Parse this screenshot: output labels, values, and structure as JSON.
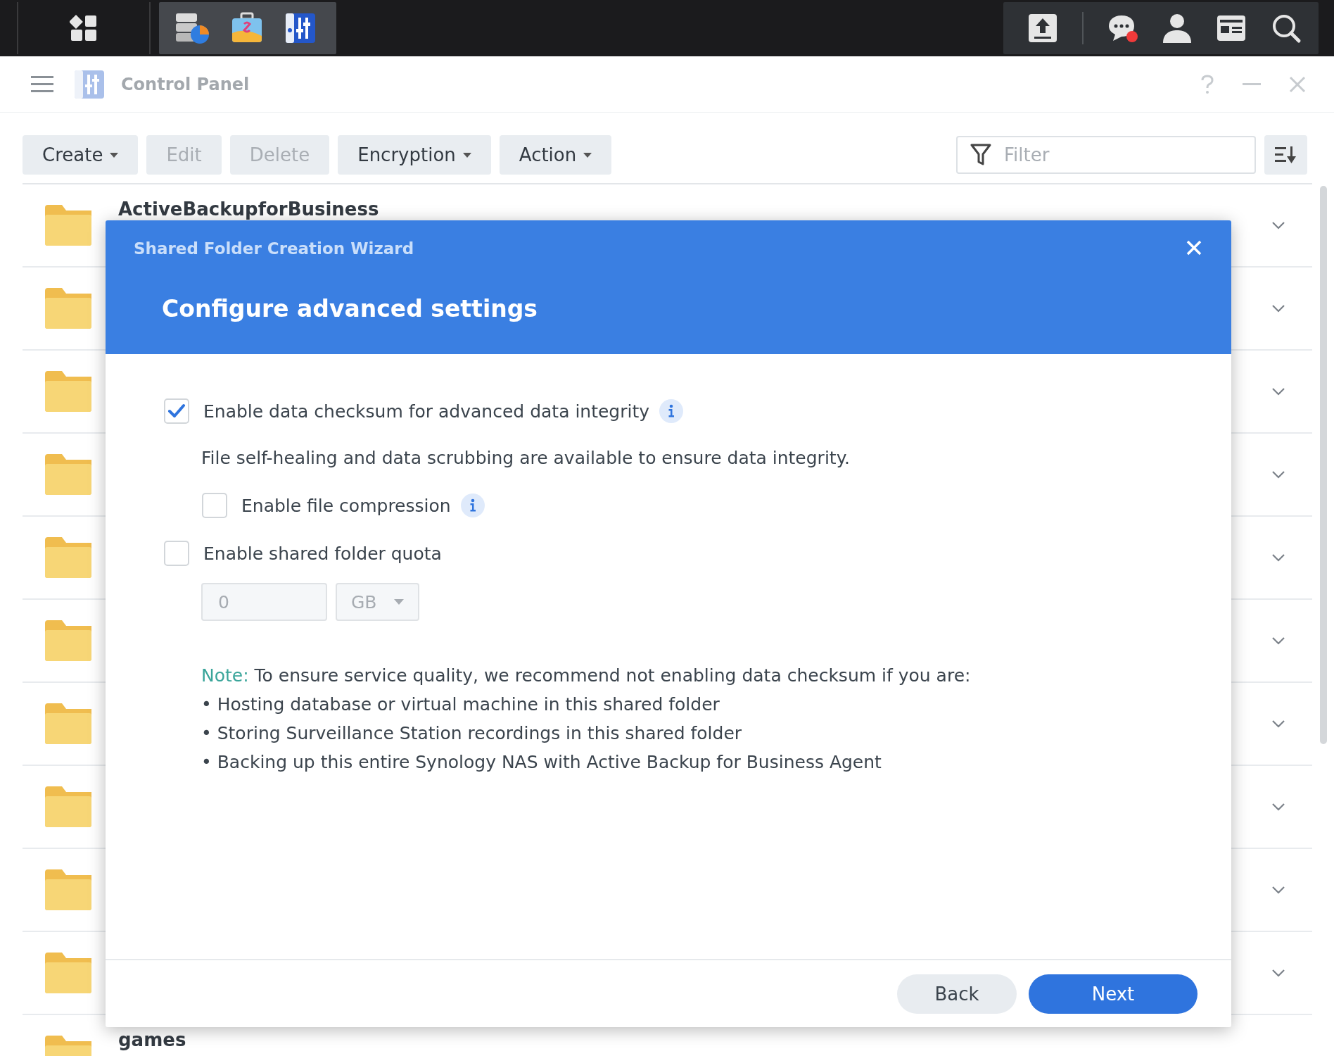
{
  "taskbar": {
    "notification": true
  },
  "window": {
    "title": "Control Panel"
  },
  "toolbar": {
    "buttons": [
      {
        "label": "Create",
        "disabled": false,
        "dropdown": true
      },
      {
        "label": "Edit",
        "disabled": true,
        "dropdown": false
      },
      {
        "label": "Delete",
        "disabled": true,
        "dropdown": false
      },
      {
        "label": "Encryption",
        "disabled": false,
        "dropdown": true
      },
      {
        "label": "Action",
        "disabled": false,
        "dropdown": true
      }
    ],
    "filter": {
      "placeholder": "Filter"
    }
  },
  "folders": [
    {
      "name": "ActiveBackupforBusiness",
      "expanded": false
    },
    {
      "expanded": false
    },
    {
      "expanded": false
    },
    {
      "expanded": false
    },
    {
      "expanded": false
    },
    {
      "expanded": false
    },
    {
      "expanded": false
    },
    {
      "expanded": false
    },
    {
      "expanded": false
    },
    {
      "expanded": false
    },
    {
      "name": "games"
    }
  ],
  "dialog": {
    "subtitle": "Shared Folder Creation Wizard",
    "title": "Configure advanced settings",
    "checksum": {
      "label": "Enable data checksum for advanced data integrity",
      "checked": true,
      "info": true,
      "description": "File self-healing and data scrubbing are available to ensure data integrity."
    },
    "compression": {
      "label": "Enable file compression",
      "checked": false,
      "info": true
    },
    "quota": {
      "label": "Enable shared folder quota",
      "checked": false,
      "value": "0",
      "unit": "GB",
      "disabled": true
    },
    "note": {
      "label": "Note:",
      "text": "To ensure service quality, we recommend not enabling data checksum if you are:",
      "bullets": [
        "• Hosting database or virtual machine in this shared folder",
        "• Storing Surveillance Station recordings in this shared folder",
        "• Backing up this entire Synology NAS with Active Backup for Business Agent"
      ]
    },
    "buttons": [
      {
        "label": "Back",
        "kind": "secondary"
      },
      {
        "label": "Next",
        "kind": "primary"
      }
    ]
  }
}
